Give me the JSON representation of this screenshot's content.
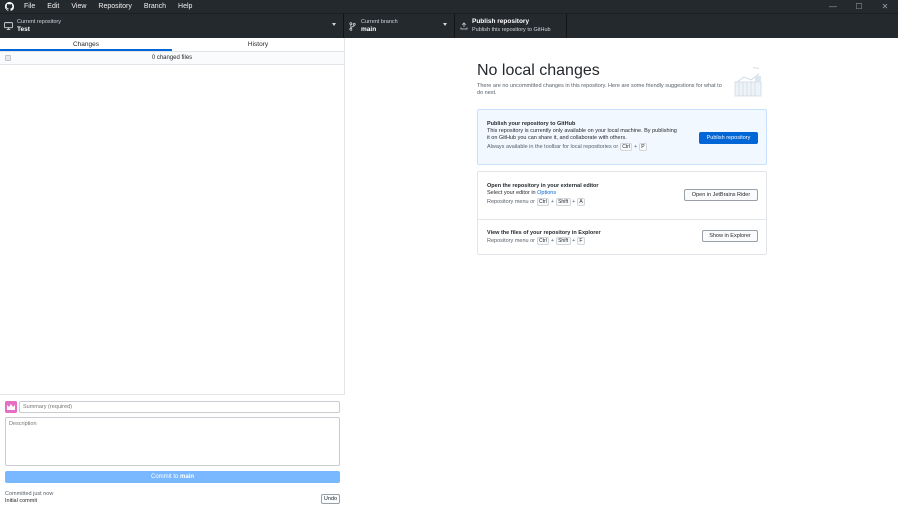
{
  "menu": [
    "File",
    "Edit",
    "View",
    "Repository",
    "Branch",
    "Help"
  ],
  "window_controls": {
    "minimize": "—",
    "maximize": "☐",
    "close": "✕"
  },
  "toolbar": {
    "repo_label": "Current repository",
    "repo_value": "Test",
    "branch_label": "Current branch",
    "branch_value": "main",
    "publish_title": "Publish repository",
    "publish_desc": "Publish this repository to GitHub"
  },
  "tabs": {
    "changes": "Changes",
    "history": "History"
  },
  "changes": {
    "count_text": "0 changed files"
  },
  "commit": {
    "summary_placeholder": "Summary (required)",
    "description_placeholder": "Description",
    "button_prefix": "Commit to",
    "button_branch": "main",
    "last_commit_time": "Committed just now",
    "last_commit_message": "Initial commit",
    "undo_label": "Undo"
  },
  "empty_state": {
    "title": "No local changes",
    "subtitle": "There are no uncommitted changes in this repository. Here are some friendly suggestions for what to do next."
  },
  "publish_card": {
    "title": "Publish your repository to GitHub",
    "text": "This repository is currently only available on your local machine. By publishing it on GitHub you can share it, and collaborate with others.",
    "hint_prefix": "Always available in the toolbar for local repositories or",
    "hint_keys": [
      "Ctrl",
      "P"
    ],
    "button_label": "Publish repository"
  },
  "editor_card": {
    "title": "Open the repository in your external editor",
    "text_prefix": "Select your editor in",
    "text_link": "Options",
    "hint_prefix": "Repository menu or",
    "hint_keys": [
      "Ctrl",
      "Shift",
      "A"
    ],
    "button_label": "Open in JetBrains Rider"
  },
  "explorer_card": {
    "title": "View the files of your repository in Explorer",
    "hint_prefix": "Repository menu or",
    "hint_keys": [
      "Ctrl",
      "Shift",
      "F"
    ],
    "button_label": "Show in Explorer"
  },
  "colors": {
    "titlebar": "#24292e",
    "accent": "#0366d6",
    "commit_button": "#79b8ff",
    "avatar": "#e46fc3"
  }
}
